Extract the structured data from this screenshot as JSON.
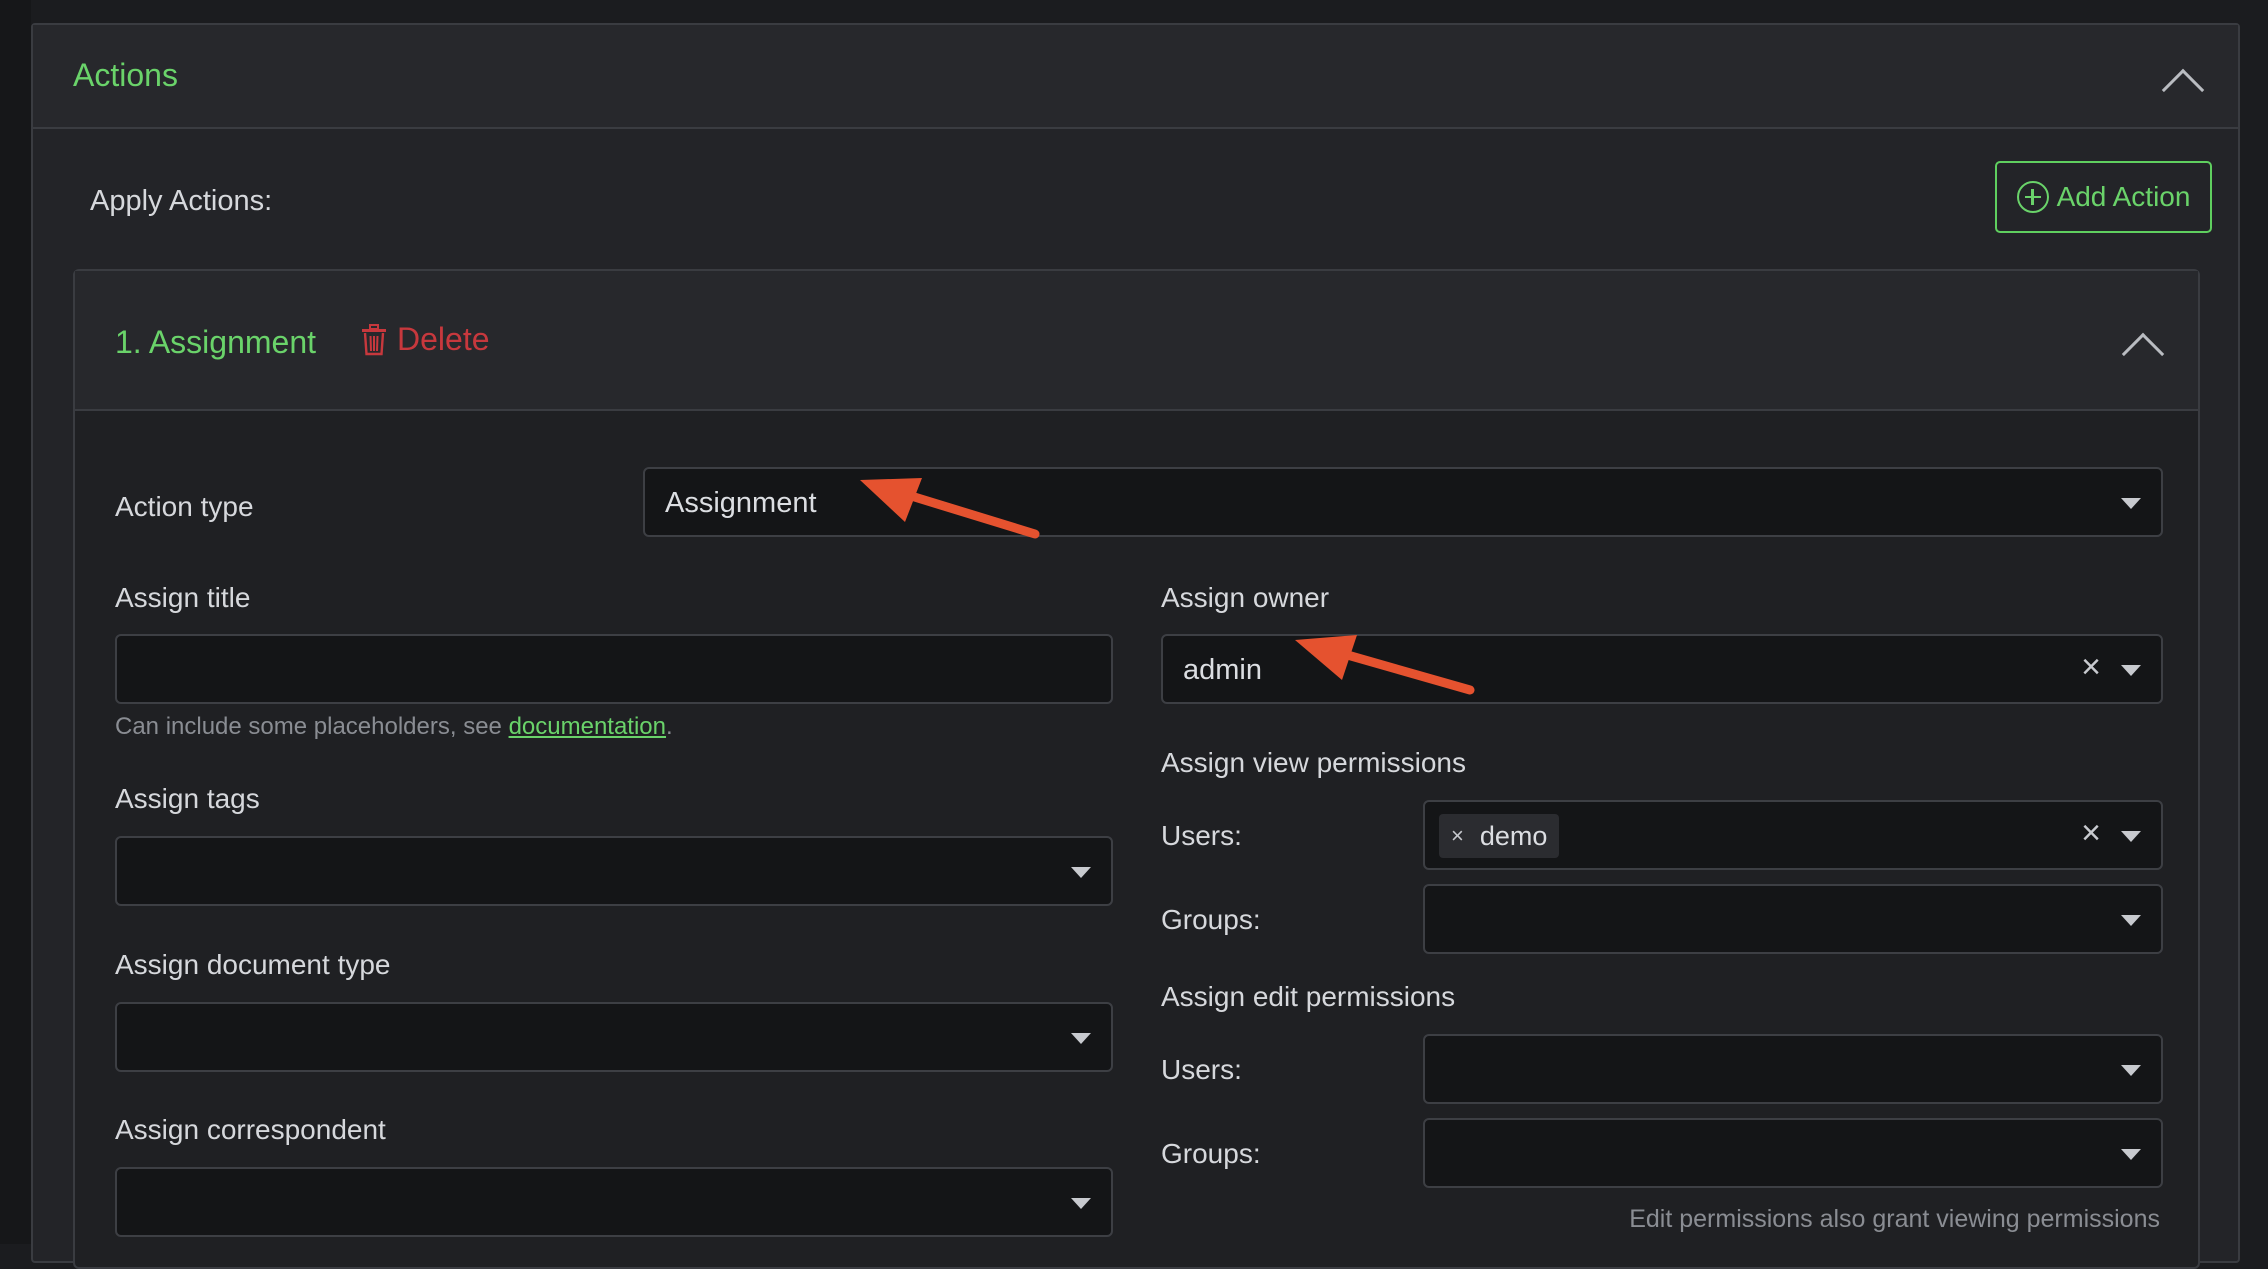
{
  "panel": {
    "title": "Actions"
  },
  "apply": {
    "label": "Apply Actions:",
    "add_button": "Add Action"
  },
  "card": {
    "title": "1. Assignment",
    "delete_label": "Delete"
  },
  "form": {
    "action_type": {
      "label": "Action type",
      "value": "Assignment"
    },
    "assign_title": {
      "label": "Assign title",
      "value": "",
      "hint_prefix": "Can include some placeholders, see ",
      "hint_link": "documentation",
      "hint_suffix": "."
    },
    "assign_tags": {
      "label": "Assign tags"
    },
    "assign_document_type": {
      "label": "Assign document type"
    },
    "assign_correspondent": {
      "label": "Assign correspondent"
    },
    "assign_owner": {
      "label": "Assign owner",
      "value": "admin"
    },
    "view_permissions": {
      "label": "Assign view permissions",
      "users_label": "Users:",
      "users_tags": [
        "demo"
      ],
      "groups_label": "Groups:"
    },
    "edit_permissions": {
      "label": "Assign edit permissions",
      "users_label": "Users:",
      "groups_label": "Groups:",
      "note": "Edit permissions also grant viewing permissions"
    }
  },
  "colors": {
    "accent_green": "#6ad36a",
    "danger_red": "#c7383d",
    "annotation_arrow": "#e5522f"
  },
  "icons": {
    "collapse": "chevron-up-icon",
    "add": "plus-circle-icon",
    "delete": "trash-icon",
    "dropdown": "caret-down-icon",
    "clear": "close-icon"
  }
}
